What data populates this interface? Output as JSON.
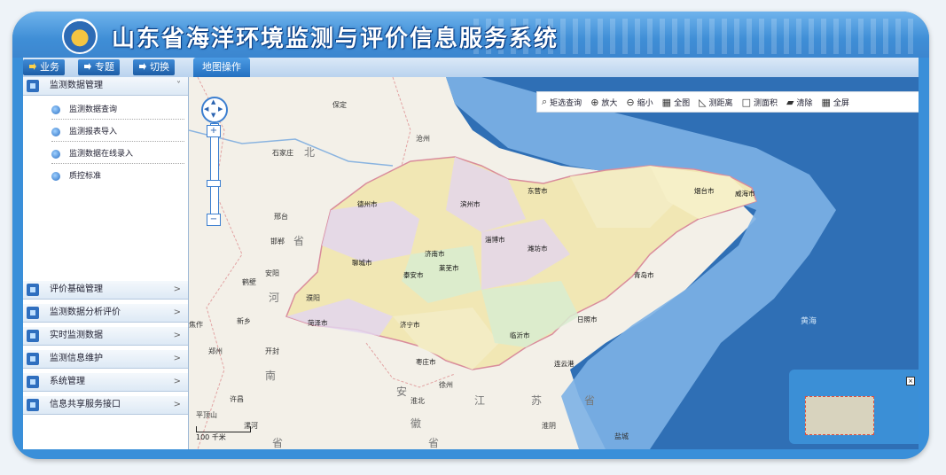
{
  "app": {
    "title": "山东省海洋环境监测与评价信息服务系统"
  },
  "colors": {
    "frame": "#3a8fd9",
    "sea_deep": "#2f6fb5",
    "sea_shallow": "#7db1e6",
    "land": "#f3f0e8",
    "province": "#f1e7b4"
  },
  "nav": {
    "buttons": [
      {
        "label": "业务",
        "icon": "arrow-icon"
      },
      {
        "label": "专题",
        "icon": "arrow-icon"
      },
      {
        "label": "切换",
        "icon": "arrow-icon"
      }
    ],
    "map_tab": "地图操作"
  },
  "sidebar": {
    "top": {
      "label": "监测数据管理",
      "arrow": "˅"
    },
    "items": [
      {
        "label": "监测数据查询"
      },
      {
        "label": "监测报表导入"
      },
      {
        "label": "监测数据在线录入"
      },
      {
        "label": "质控标准"
      }
    ],
    "sections": [
      {
        "label": "评价基础管理",
        "arrow": ">"
      },
      {
        "label": "监测数据分析评价",
        "arrow": ">"
      },
      {
        "label": "实时监测数据",
        "arrow": ">"
      },
      {
        "label": "监测信息维护",
        "arrow": ">"
      },
      {
        "label": "系统管理",
        "arrow": ">"
      },
      {
        "label": "信息共享服务接口",
        "arrow": ">"
      }
    ]
  },
  "maptools": [
    {
      "label": "矩选查询",
      "icon": "search-icon",
      "glyph": "⌕"
    },
    {
      "label": "放大",
      "icon": "zoom-in-icon",
      "glyph": "⊕"
    },
    {
      "label": "缩小",
      "icon": "zoom-out-icon",
      "glyph": "⊖"
    },
    {
      "label": "全图",
      "icon": "full-map-icon",
      "glyph": "▦"
    },
    {
      "label": "测距离",
      "icon": "measure-distance-icon",
      "glyph": "◺"
    },
    {
      "label": "测面积",
      "icon": "measure-area-icon",
      "glyph": "□"
    },
    {
      "label": "清除",
      "icon": "eraser-icon",
      "glyph": "▰"
    },
    {
      "label": "全屏",
      "icon": "fullscreen-icon",
      "glyph": "▦"
    }
  ],
  "map": {
    "scale_label": "100 千米",
    "labels": {
      "baoding": "保定",
      "shijiazhuang": "石家庄",
      "bei": "北",
      "cangzhou": "沧州",
      "dongying": "东营市",
      "dezhou": "德州市",
      "binzhou": "滨州市",
      "yantai": "烟台市",
      "weihai": "威海市",
      "xingtai": "邢台",
      "handan": "邯郸",
      "sheng1": "省",
      "zibo": "淄博市",
      "weifang": "潍坊市",
      "jinan": "济南市",
      "liaocheng": "聊城市",
      "laiwu": "莱芜市",
      "taian": "泰安市",
      "qingdao": "青岛市",
      "hebi": "鹤壁",
      "anyang": "安阳",
      "puyang": "濮阳",
      "he": "河",
      "heze": "菏泽市",
      "jining": "济宁市",
      "rizhao": "日照市",
      "linyi": "临沂市",
      "xinxiang": "新乡",
      "zuo": "焦作",
      "huanghai": "黄海",
      "zhengzhou": "郑州",
      "kaifeng": "开封",
      "zaozhuang": "枣庄市",
      "lianyungang": "连云港",
      "nan": "南",
      "xuzhou": "徐州",
      "an": "安",
      "huaibei": "淮北",
      "jiang": "江",
      "su": "苏",
      "sheng2": "省",
      "xuchang": "许昌",
      "pingdingshan": "平顶山",
      "luohe": "漯河",
      "hui": "徽",
      "huaiyin": "淮阴",
      "yancheng": "盐城",
      "sheng3": "省",
      "sheng4": "省"
    }
  }
}
